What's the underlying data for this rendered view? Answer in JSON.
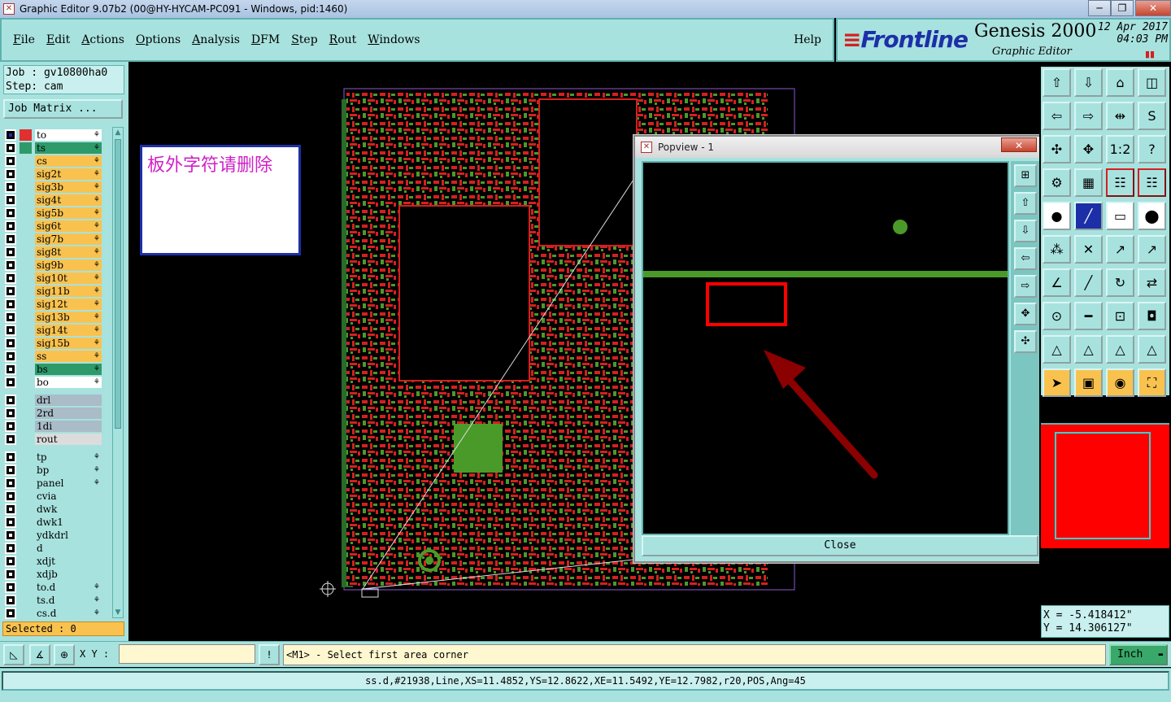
{
  "window": {
    "title": "Graphic Editor 9.07b2 (00@HY-HYCAM-PC091 - Windows, pid:1460)",
    "controls": [
      "─",
      "❐",
      "✕"
    ]
  },
  "menu": {
    "items": [
      "File",
      "Edit",
      "Actions",
      "Options",
      "Analysis",
      "DFM",
      "Step",
      "Rout",
      "Windows"
    ],
    "help": "Help"
  },
  "brand": {
    "logo": "Frontline",
    "product": "Genesis 2000",
    "subtitle": "Graphic Editor",
    "date": "12 Apr 2017",
    "time": "04:03 PM"
  },
  "job": {
    "job_line": "Job : gv10800ha0",
    "step_line": "Step: cam",
    "matrix_button": "Job Matrix ..."
  },
  "layers_group1": [
    {
      "name": "to",
      "color": "#ffffff",
      "swatch": "#e03030",
      "mark": "⚘",
      "checked": true
    },
    {
      "name": "ts",
      "color": "#2e9a6a",
      "swatch": "#2e9a6a",
      "mark": "⚘",
      "checked": false
    },
    {
      "name": "cs",
      "color": "#f9c24f",
      "swatch": "",
      "mark": "⚘",
      "checked": false
    },
    {
      "name": "sig2t",
      "color": "#f9c24f",
      "swatch": "",
      "mark": "⚘",
      "checked": false
    },
    {
      "name": "sig3b",
      "color": "#f9c24f",
      "swatch": "",
      "mark": "⚘",
      "checked": false
    },
    {
      "name": "sig4t",
      "color": "#f9c24f",
      "swatch": "",
      "mark": "⚘",
      "checked": false
    },
    {
      "name": "sig5b",
      "color": "#f9c24f",
      "swatch": "",
      "mark": "⚘",
      "checked": false
    },
    {
      "name": "sig6t",
      "color": "#f9c24f",
      "swatch": "",
      "mark": "⚘",
      "checked": false
    },
    {
      "name": "sig7b",
      "color": "#f9c24f",
      "swatch": "",
      "mark": "⚘",
      "checked": false
    },
    {
      "name": "sig8t",
      "color": "#f9c24f",
      "swatch": "",
      "mark": "⚘",
      "checked": false
    },
    {
      "name": "sig9b",
      "color": "#f9c24f",
      "swatch": "",
      "mark": "⚘",
      "checked": false
    },
    {
      "name": "sig10t",
      "color": "#f9c24f",
      "swatch": "",
      "mark": "⚘",
      "checked": false
    },
    {
      "name": "sig11b",
      "color": "#f9c24f",
      "swatch": "",
      "mark": "⚘",
      "checked": false
    },
    {
      "name": "sig12t",
      "color": "#f9c24f",
      "swatch": "",
      "mark": "⚘",
      "checked": false
    },
    {
      "name": "sig13b",
      "color": "#f9c24f",
      "swatch": "",
      "mark": "⚘",
      "checked": false
    },
    {
      "name": "sig14t",
      "color": "#f9c24f",
      "swatch": "",
      "mark": "⚘",
      "checked": false
    },
    {
      "name": "sig15b",
      "color": "#f9c24f",
      "swatch": "",
      "mark": "⚘",
      "checked": false
    },
    {
      "name": "ss",
      "color": "#f9c24f",
      "swatch": "",
      "mark": "⚘",
      "checked": false
    },
    {
      "name": "bs",
      "color": "#2e9a6a",
      "swatch": "",
      "mark": "⚘",
      "checked": false
    },
    {
      "name": "bo",
      "color": "#ffffff",
      "swatch": "",
      "mark": "⚘",
      "checked": false
    }
  ],
  "layers_group2": [
    {
      "name": "drl",
      "color": "#a9bcc8"
    },
    {
      "name": "2rd",
      "color": "#a9bcc8"
    },
    {
      "name": "1di",
      "color": "#a9bcc8"
    },
    {
      "name": "rout",
      "color": "#dcdcdc"
    }
  ],
  "layers_group3": [
    {
      "name": "tp",
      "mark": "⚘"
    },
    {
      "name": "bp",
      "mark": "⚘"
    },
    {
      "name": "panel",
      "mark": "⚘"
    },
    {
      "name": "cvia",
      "mark": ""
    },
    {
      "name": "dwk",
      "mark": ""
    },
    {
      "name": "dwk1",
      "mark": ""
    },
    {
      "name": "ydkdrl",
      "mark": ""
    },
    {
      "name": "d",
      "mark": ""
    },
    {
      "name": "xdjt",
      "mark": ""
    },
    {
      "name": "xdjb",
      "mark": ""
    },
    {
      "name": "to.d",
      "mark": "⚘"
    },
    {
      "name": "ts.d",
      "mark": "⚘"
    },
    {
      "name": "cs.d",
      "mark": "⚘"
    }
  ],
  "selected": "Selected : 0",
  "annotation": "板外字符请删除",
  "popview": {
    "title": "Popview - 1",
    "close_x": "✕",
    "close_button": "Close"
  },
  "coords": {
    "x": "X = -5.418412\"",
    "y": "Y = 14.306127\""
  },
  "command": {
    "xy_label": "X Y :",
    "xy_value": "",
    "prompt": "<M1> - Select first area corner",
    "units": "Inch"
  },
  "status": "ss.d,#21938,Line,XS=11.4852,YS=12.8622,XE=11.5492,YE=12.7982,r20,POS,Ang=45",
  "colors": {
    "panel": "#a8e2de",
    "board_red": "#d42020",
    "board_green": "#4a9a2a",
    "selection_red": "#ff0000",
    "arrow": "#8b0000"
  }
}
